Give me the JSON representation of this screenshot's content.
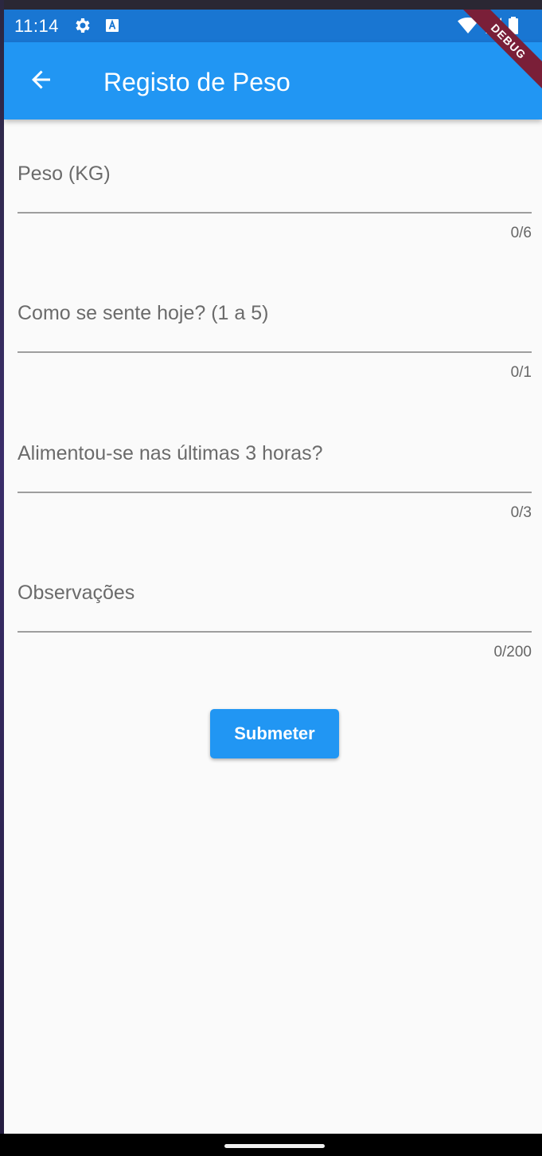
{
  "status_bar": {
    "time": "11:14",
    "icons": [
      "gear-icon",
      "a-badge-icon",
      "wifi-icon",
      "signal-icon",
      "battery-icon"
    ]
  },
  "app_bar": {
    "title": "Registo de Peso",
    "back_icon": "arrow-left-icon",
    "debug_banner": "DEBUG"
  },
  "form": {
    "fields": [
      {
        "label": "Peso (KG)",
        "counter": "0/6"
      },
      {
        "label": "Como se sente hoje? (1 a 5)",
        "counter": "0/1"
      },
      {
        "label": "Alimentou-se nas últimas 3 horas?",
        "counter": "0/3"
      },
      {
        "label": "Observações",
        "counter": "0/200"
      }
    ],
    "submit_label": "Submeter"
  },
  "colors": {
    "primary": "#2196f3",
    "status_bar": "#1976d2",
    "background": "#fafafa",
    "debug": "#7a1f38"
  }
}
